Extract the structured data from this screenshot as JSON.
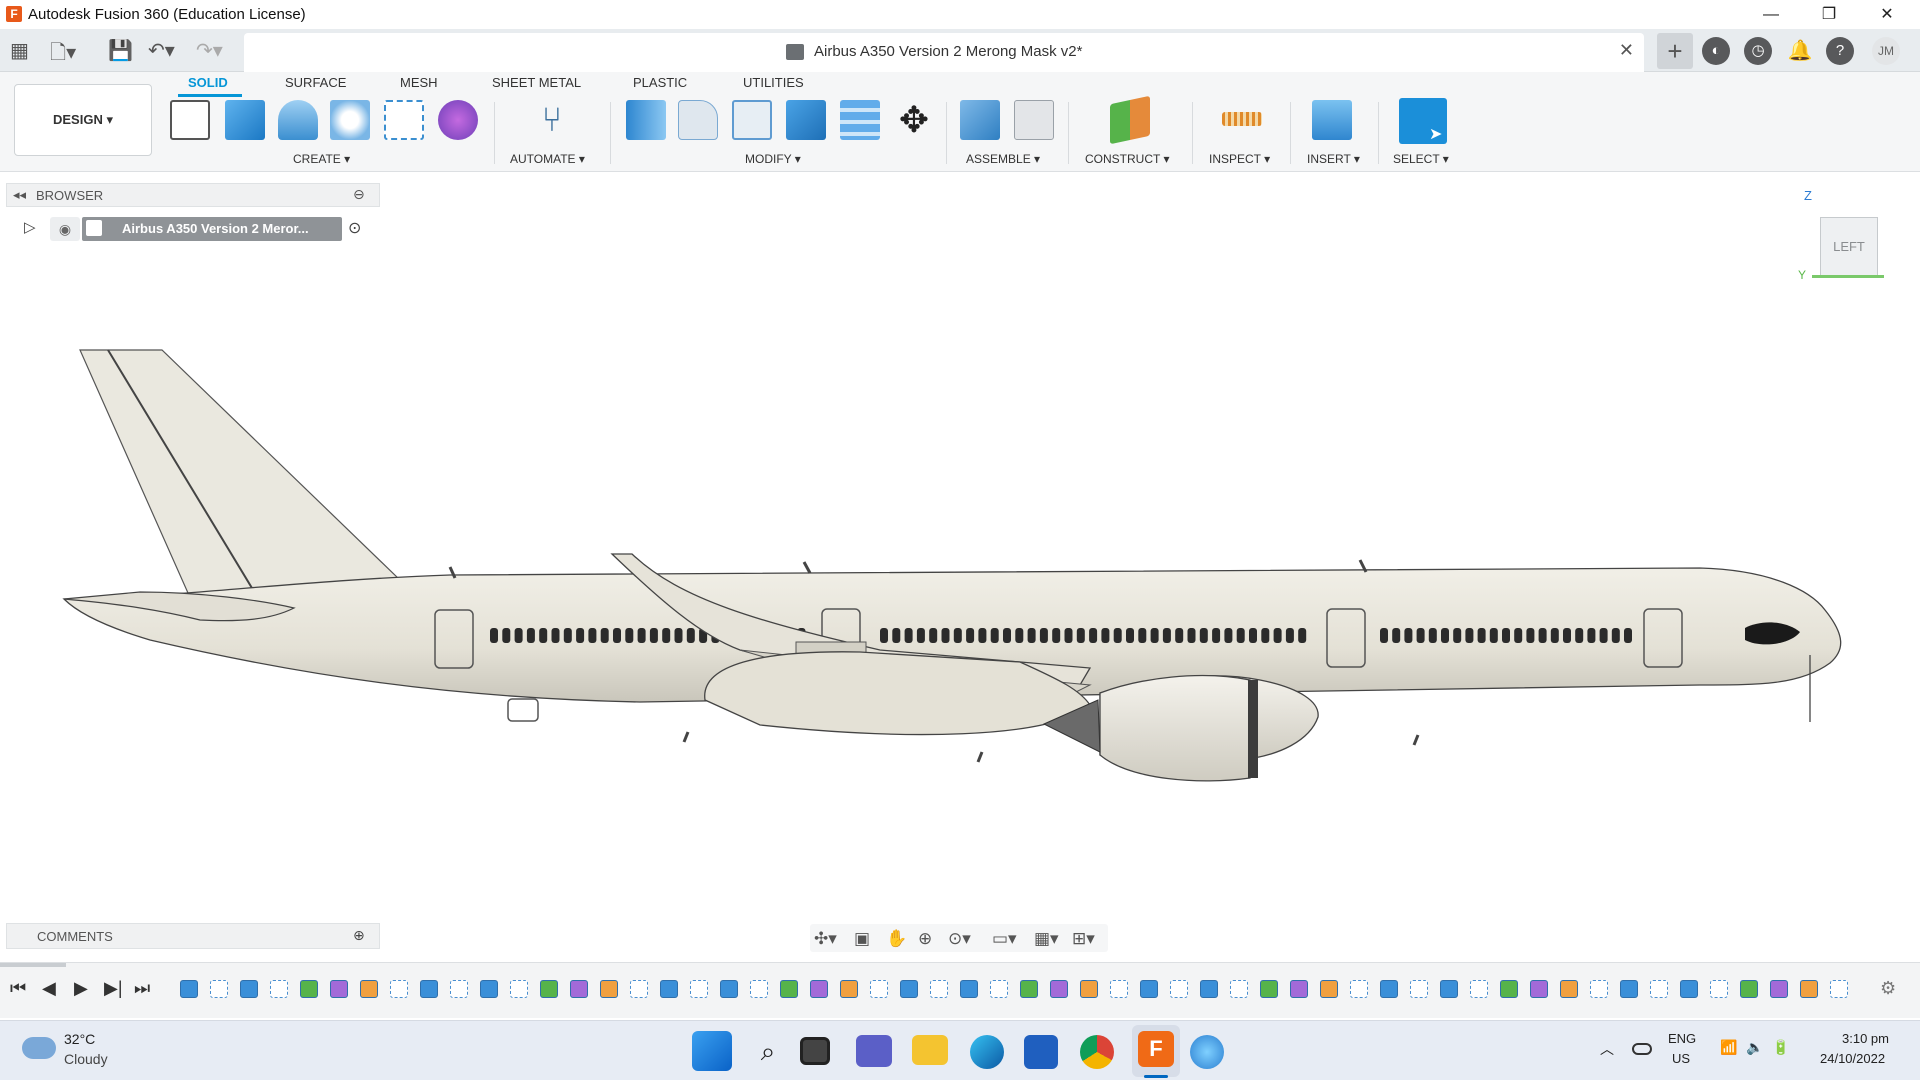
{
  "window": {
    "title": "Autodesk Fusion 360 (Education License)",
    "logo_letter": "F",
    "controls": [
      "—",
      "❐",
      "✕"
    ]
  },
  "document_tab": {
    "title": "Airbus A350 Version 2 Merong Mask v2*",
    "close": "✕"
  },
  "user": {
    "initials": "JM"
  },
  "toolbar": {
    "workspace": "DESIGN ▾",
    "tabs": [
      "SOLID",
      "SURFACE",
      "MESH",
      "SHEET METAL",
      "PLASTIC",
      "UTILITIES"
    ],
    "active_tab": "SOLID",
    "groups": {
      "create": "CREATE ▾",
      "automate": "AUTOMATE ▾",
      "modify": "MODIFY ▾",
      "assemble": "ASSEMBLE ▾",
      "construct": "CONSTRUCT ▾",
      "inspect": "INSPECT ▾",
      "insert": "INSERT ▾",
      "select": "SELECT ▾"
    }
  },
  "browser": {
    "header": "BROWSER",
    "root_item": "Airbus A350 Version 2 Meror..."
  },
  "comments": {
    "label": "COMMENTS"
  },
  "viewcube": {
    "face": "LEFT",
    "axis_z": "Z",
    "axis_y": "Y"
  },
  "taskbar": {
    "weather_temp": "32°C",
    "weather_desc": "Cloudy",
    "lang_line1": "ENG",
    "lang_line2": "US",
    "time": "3:10 pm",
    "date": "24/10/2022",
    "fusion_badge": "F"
  },
  "colors": {
    "accent": "#0696d7",
    "fusion_orange": "#e8591a",
    "select_blue": "#1b8fd9",
    "fuselage": "#e9e6dc"
  }
}
